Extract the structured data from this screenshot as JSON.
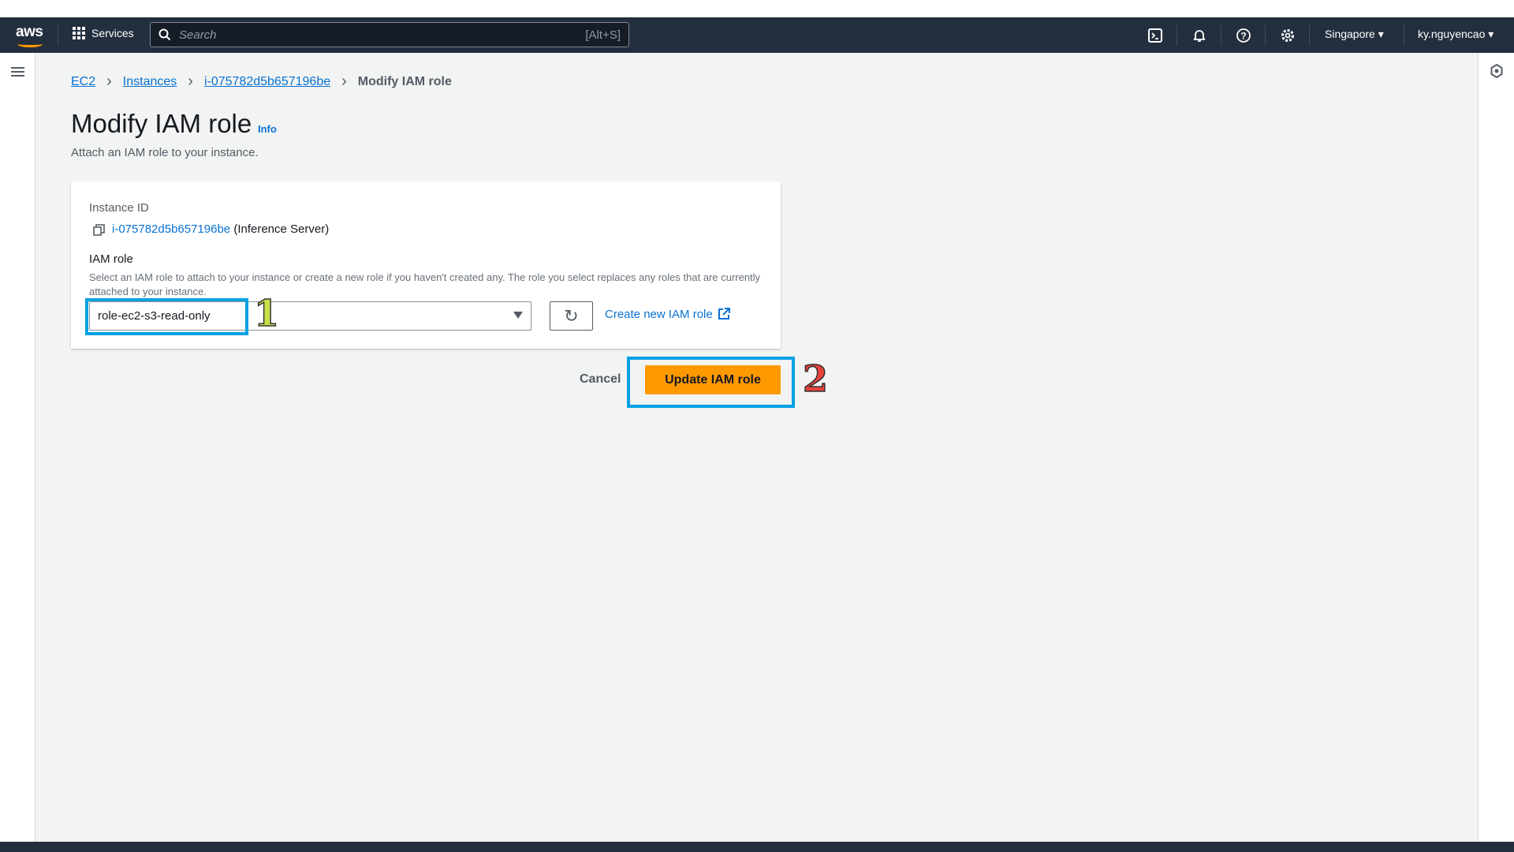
{
  "nav": {
    "logo": "aws",
    "services": "Services",
    "search_placeholder": "Search",
    "search_shortcut": "[Alt+S]",
    "region": "Singapore ▾",
    "user": "ky.nguyencao ▾"
  },
  "breadcrumb": [
    "EC2",
    "Instances",
    "i-075782d5b657196be",
    "Modify IAM role"
  ],
  "page": {
    "title": "Modify IAM role",
    "info": "Info",
    "subtitle": "Attach an IAM role to your instance."
  },
  "form": {
    "instance_label": "Instance ID",
    "instance_id": "i-075782d5b657196be",
    "instance_name": "(Inference Server)",
    "role_label": "IAM role",
    "role_description": "Select an IAM role to attach to your instance or create a new role if you haven't created any. The role you select replaces any roles that are currently attached to your instance.",
    "role_value": "role-ec2-s3-read-only",
    "create_link": "Create new IAM role"
  },
  "actions": {
    "cancel": "Cancel",
    "update": "Update IAM role"
  },
  "annotations": {
    "step1": "1",
    "step2": "2",
    "step1_color": "#c8e04a",
    "step2_color": "#e8413c",
    "highlight_color": "#00a1e4"
  }
}
